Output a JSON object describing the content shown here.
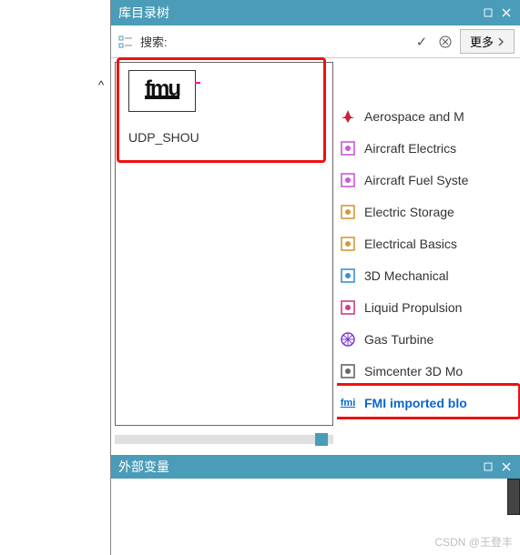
{
  "panel1": {
    "title": "库目录树",
    "pin_tip": "pin",
    "close_tip": "close"
  },
  "search": {
    "label": "搜索:",
    "placeholder": "",
    "more": "更多"
  },
  "block": {
    "logo_text": "fmu",
    "label": "UDP_SHOU"
  },
  "library": {
    "items": [
      {
        "name": "aerospace-icon",
        "label": "Aerospace and M",
        "color": "#c23"
      },
      {
        "name": "aircraft-electrics-icon",
        "label": "Aircraft Electrics",
        "color": "#c95ad6"
      },
      {
        "name": "aircraft-fuel-icon",
        "label": "Aircraft Fuel Syste",
        "color": "#c95ad6"
      },
      {
        "name": "electric-storage-icon",
        "label": "Electric Storage",
        "color": "#d29b3b"
      },
      {
        "name": "electrical-basics-icon",
        "label": "Electrical Basics",
        "color": "#d29b3b"
      },
      {
        "name": "3d-mechanical-icon",
        "label": "3D Mechanical",
        "color": "#3b90d2"
      },
      {
        "name": "liquid-propulsion-icon",
        "label": "Liquid Propulsion",
        "color": "#d23b8a"
      },
      {
        "name": "gas-turbine-icon",
        "label": "Gas Turbine",
        "color": "#7a3bd2"
      },
      {
        "name": "simcenter-3d-icon",
        "label": "Simcenter 3D Mo",
        "color": "#666"
      },
      {
        "name": "fmi-imported-icon",
        "label": "FMI imported blo",
        "color": "#0a68c8",
        "selected": true
      }
    ]
  },
  "panel2": {
    "title": "外部变量"
  },
  "side_caret": "^",
  "watermark": "CSDN @王登丰"
}
